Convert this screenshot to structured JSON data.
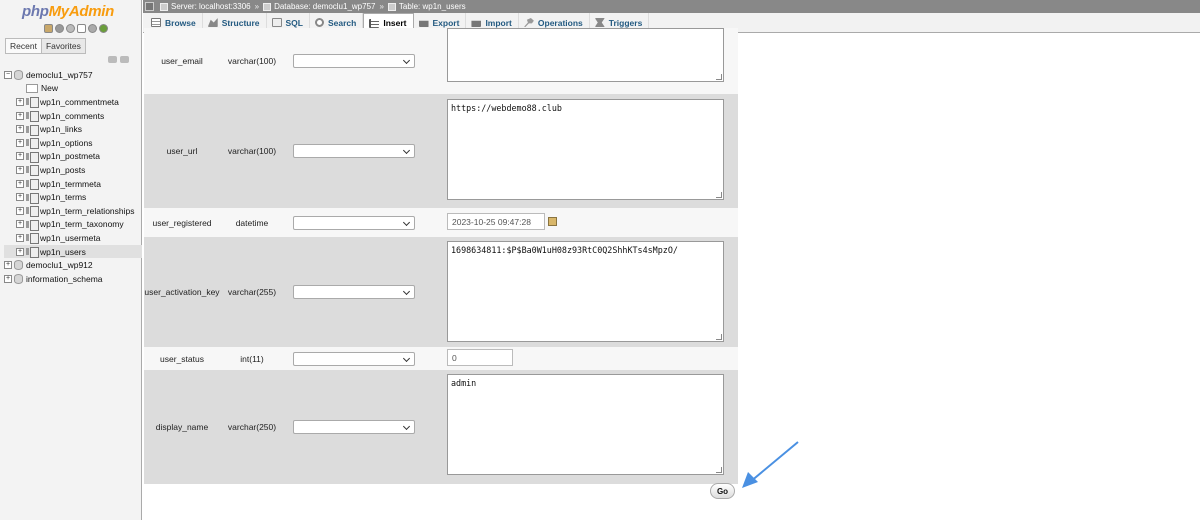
{
  "logo": {
    "php": "php",
    "my": "My",
    "admin": "Admin"
  },
  "nav": {
    "icons": [
      "home-icon",
      "exit-icon",
      "help-icon",
      "docs-icon",
      "settings-icon",
      "reload-icon"
    ],
    "tabs": [
      "Recent",
      "Favorites"
    ],
    "tree": [
      {
        "label": "democlu1_wp757",
        "level": 0,
        "kind": "db",
        "expanded": true
      },
      {
        "label": "New",
        "level": 1,
        "kind": "new"
      },
      {
        "label": "wp1n_commentmeta",
        "level": 1,
        "kind": "table"
      },
      {
        "label": "wp1n_comments",
        "level": 1,
        "kind": "table"
      },
      {
        "label": "wp1n_links",
        "level": 1,
        "kind": "table"
      },
      {
        "label": "wp1n_options",
        "level": 1,
        "kind": "table"
      },
      {
        "label": "wp1n_postmeta",
        "level": 1,
        "kind": "table"
      },
      {
        "label": "wp1n_posts",
        "level": 1,
        "kind": "table"
      },
      {
        "label": "wp1n_termmeta",
        "level": 1,
        "kind": "table"
      },
      {
        "label": "wp1n_terms",
        "level": 1,
        "kind": "table"
      },
      {
        "label": "wp1n_term_relationships",
        "level": 1,
        "kind": "table"
      },
      {
        "label": "wp1n_term_taxonomy",
        "level": 1,
        "kind": "table"
      },
      {
        "label": "wp1n_usermeta",
        "level": 1,
        "kind": "table"
      },
      {
        "label": "wp1n_users",
        "level": 1,
        "kind": "table",
        "selected": true
      },
      {
        "label": "democlu1_wp912",
        "level": 0,
        "kind": "db"
      },
      {
        "label": "information_schema",
        "level": 0,
        "kind": "db"
      }
    ]
  },
  "breadcrumb": {
    "server": "Server: localhost:3306",
    "database": "Database: democlu1_wp757",
    "table": "Table: wp1n_users",
    "separator": "»"
  },
  "tabs": [
    {
      "label": "Browse",
      "icon": "browse-icon"
    },
    {
      "label": "Structure",
      "icon": "structure-icon"
    },
    {
      "label": "SQL",
      "icon": "sql-icon"
    },
    {
      "label": "Search",
      "icon": "search-icon"
    },
    {
      "label": "Insert",
      "icon": "insert-icon",
      "active": true
    },
    {
      "label": "Export",
      "icon": "export-icon"
    },
    {
      "label": "Import",
      "icon": "import-icon"
    },
    {
      "label": "Operations",
      "icon": "operations-icon"
    },
    {
      "label": "Triggers",
      "icon": "triggers-icon"
    }
  ],
  "fields": [
    {
      "name": "user_email",
      "type": "varchar(100)",
      "value": "",
      "input": "textarea"
    },
    {
      "name": "user_url",
      "type": "varchar(100)",
      "value": "https://webdemo88.club",
      "input": "textarea"
    },
    {
      "name": "user_registered",
      "type": "datetime",
      "value": "2023-10-25 09:47:28",
      "input": "datetime"
    },
    {
      "name": "user_activation_key",
      "type": "varchar(255)",
      "value": "1698634811:$P$Ba0W1uH08z93RtC0Q2ShhKTs4sMpzO/",
      "input": "textarea"
    },
    {
      "name": "user_status",
      "type": "int(11)",
      "value": "0",
      "input": "text"
    },
    {
      "name": "display_name",
      "type": "varchar(250)",
      "value": "admin",
      "input": "textarea"
    }
  ],
  "go_button": "Go",
  "colors": {
    "annotation_arrow": "#4a90e2",
    "tab_link": "#235a81"
  }
}
